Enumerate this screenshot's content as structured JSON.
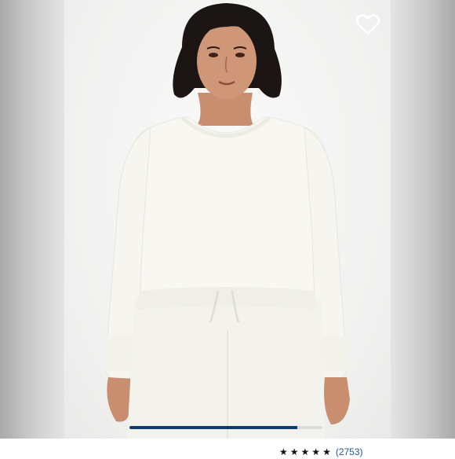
{
  "product_gallery": {
    "image_alt": "",
    "wishlist_icon": "heart-outline-icon",
    "carousel_progress": 0.87,
    "accent_color": "#0f3b66"
  },
  "rating": {
    "stars_filled": 5,
    "stars_total": 5,
    "review_count_text": "(2753)"
  }
}
